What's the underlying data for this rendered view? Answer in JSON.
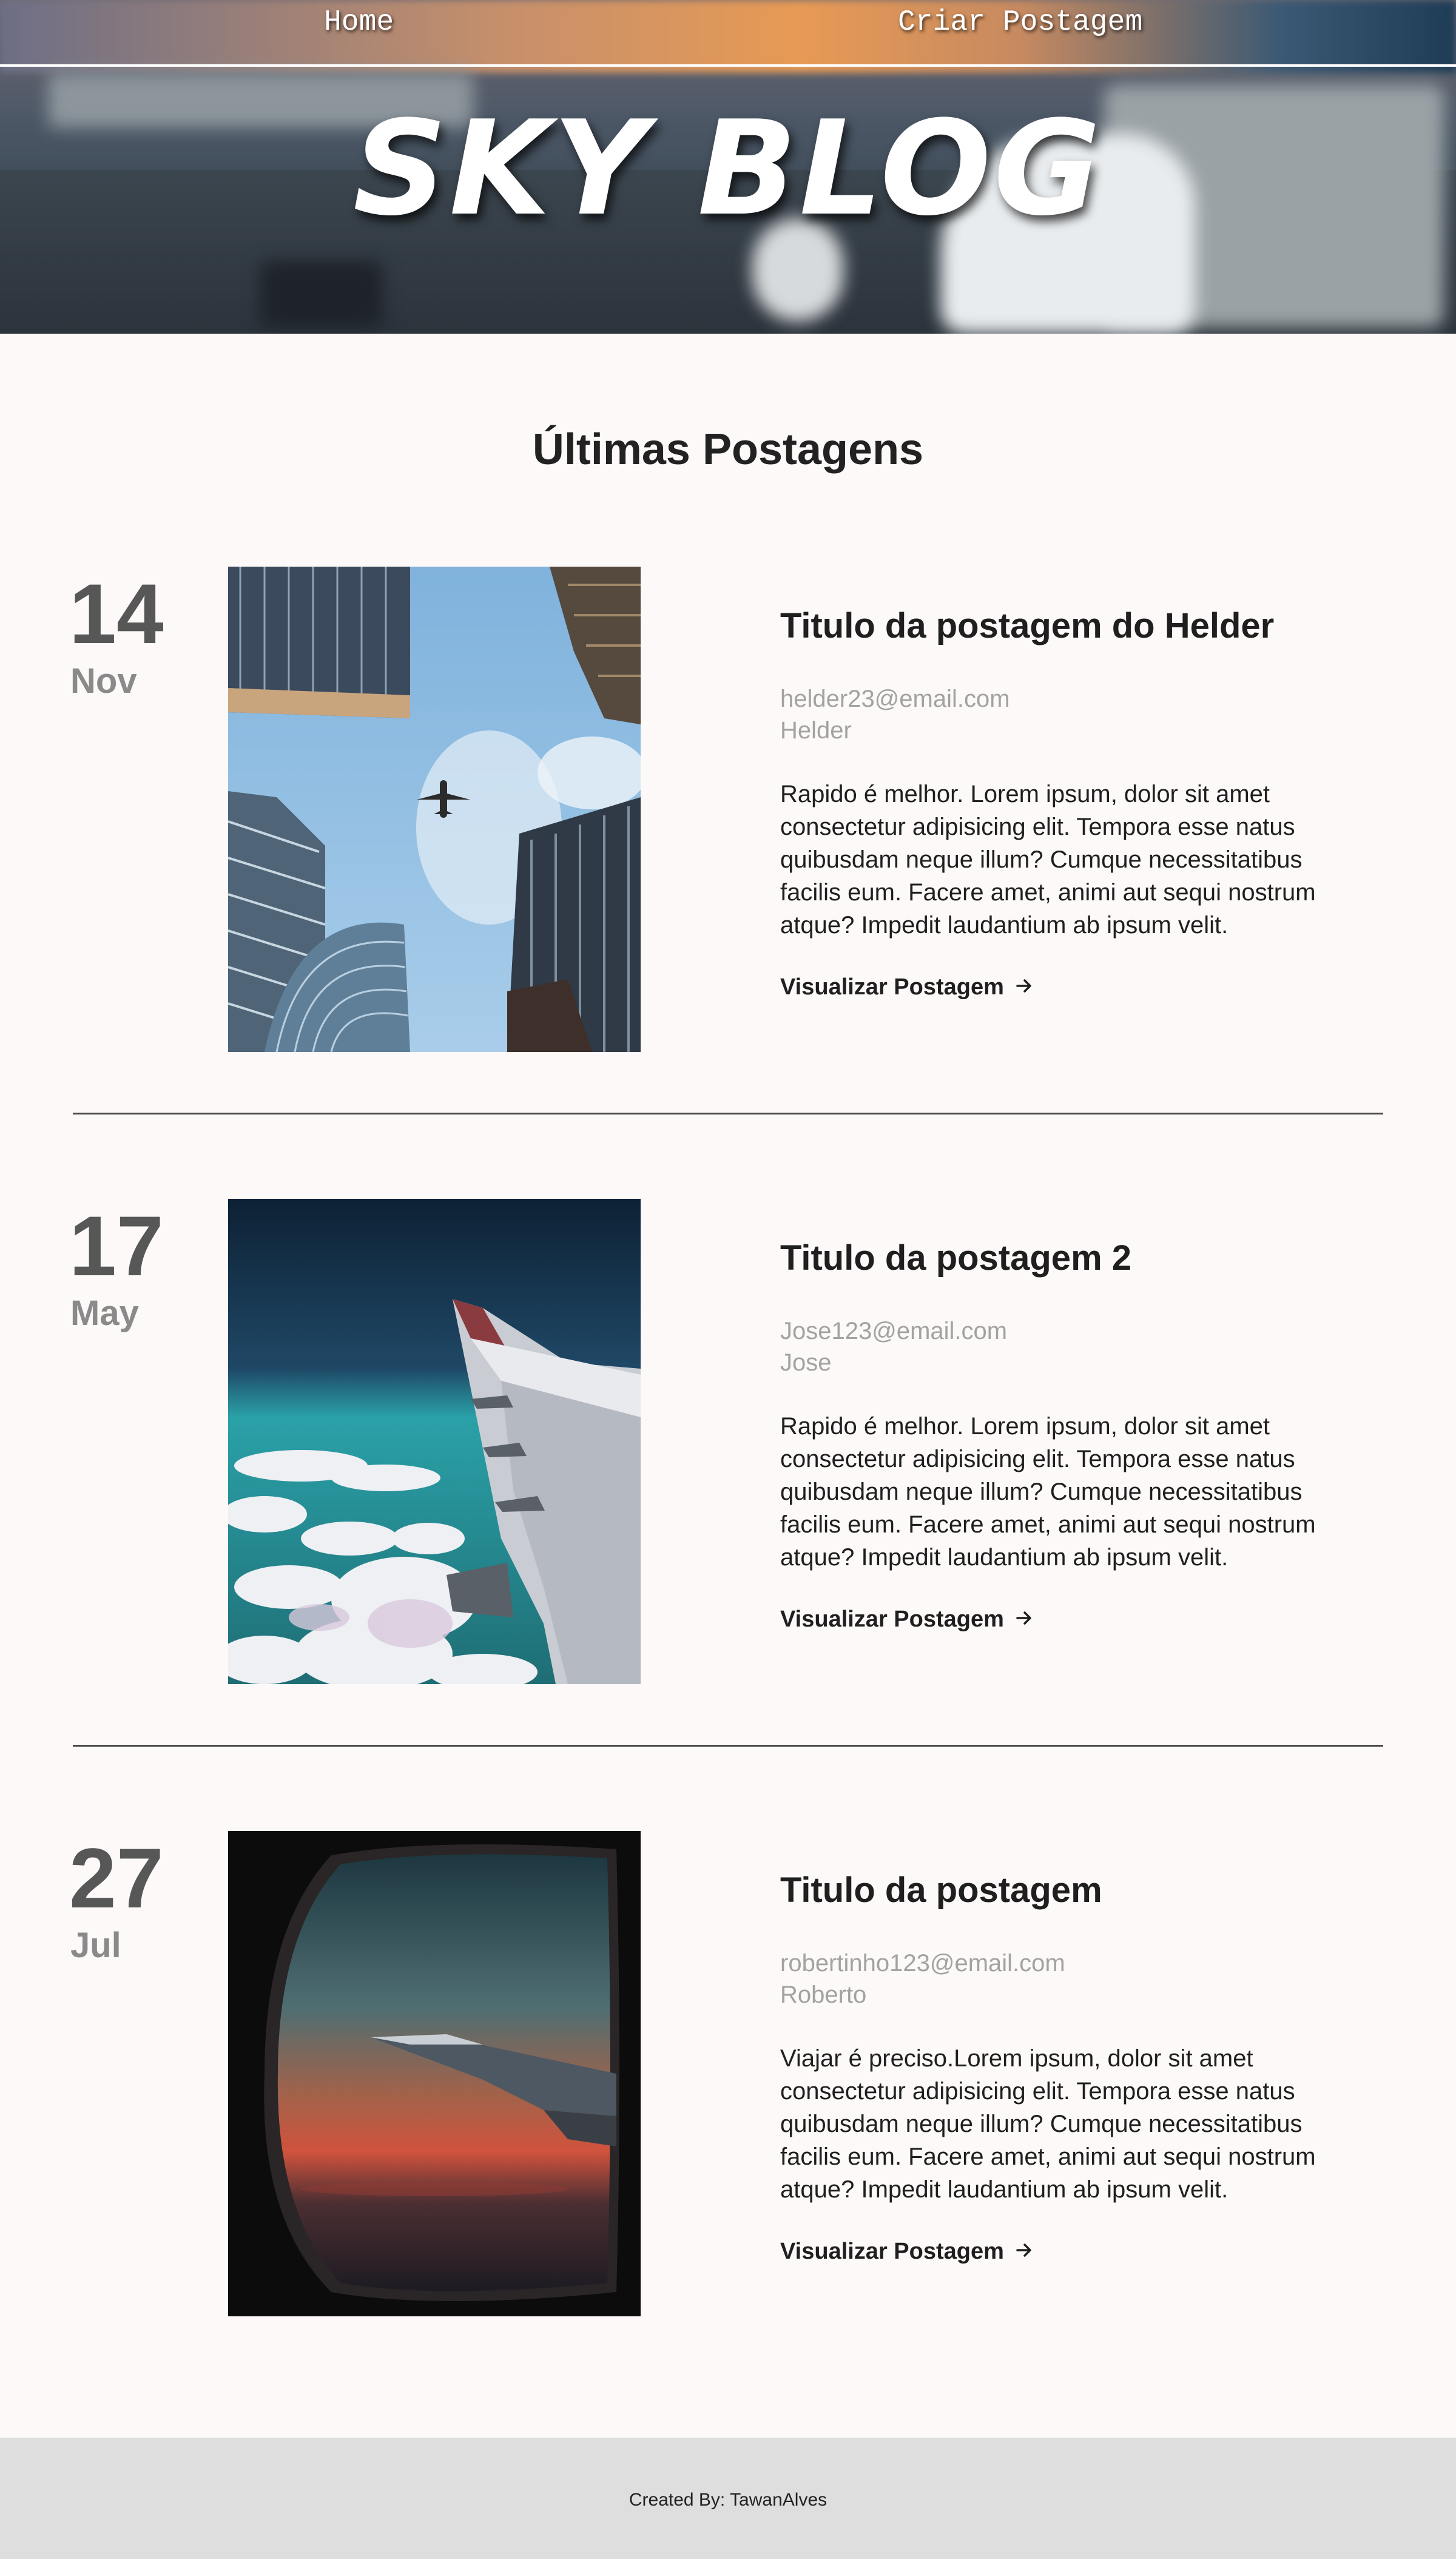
{
  "nav": {
    "home_label": "Home",
    "create_label": "Criar Postagem"
  },
  "brand": {
    "title": "SKY BLOG"
  },
  "main": {
    "section_title": "Últimas Postagens"
  },
  "posts": [
    {
      "day": "14",
      "month": "Nov",
      "image": "plane-between-skyscrapers-photo",
      "title": "Titulo da postagem do Helder",
      "email": "helder23@email.com",
      "author": "Helder",
      "excerpt": "Rapido é melhor. Lorem ipsum, dolor sit amet consectetur adipisicing elit. Tempora esse natus quibusdam neque illum? Cumque necessitatibus facilis eum. Facere amet, animi aut sequi nostrum atque? Impedit laudantium ab ipsum velit.",
      "link_label": "Visualizar Postagem"
    },
    {
      "day": "17",
      "month": "May",
      "image": "airplane-wing-over-clouds-photo",
      "title": "Titulo da postagem 2",
      "email": "Jose123@email.com",
      "author": "Jose",
      "excerpt": "Rapido é melhor. Lorem ipsum, dolor sit amet consectetur adipisicing elit. Tempora esse natus quibusdam neque illum? Cumque necessitatibus facilis eum. Facere amet, animi aut sequi nostrum atque? Impedit laudantium ab ipsum velit.",
      "link_label": "Visualizar Postagem"
    },
    {
      "day": "27",
      "month": "Jul",
      "image": "airplane-window-sunset-photo",
      "title": "Titulo da postagem",
      "email": "robertinho123@email.com",
      "author": "Roberto",
      "excerpt": "Viajar é preciso.Lorem ipsum, dolor sit amet consectetur adipisicing elit. Tempora esse natus quibusdam neque illum? Cumque necessitatibus facilis eum. Facere amet, animi aut sequi nostrum atque? Impedit laudantium ab ipsum velit.",
      "link_label": "Visualizar Postagem"
    }
  ],
  "footer": {
    "text": "Created By: TawanAlves"
  },
  "icons": {
    "link_arrow": "arrow-right-icon"
  },
  "colors": {
    "background": "#fdf9f8",
    "footer_background": "#dedede",
    "date_day": "#575757",
    "date_month": "#8a8a8a",
    "meta_text": "#a2a2a2"
  }
}
